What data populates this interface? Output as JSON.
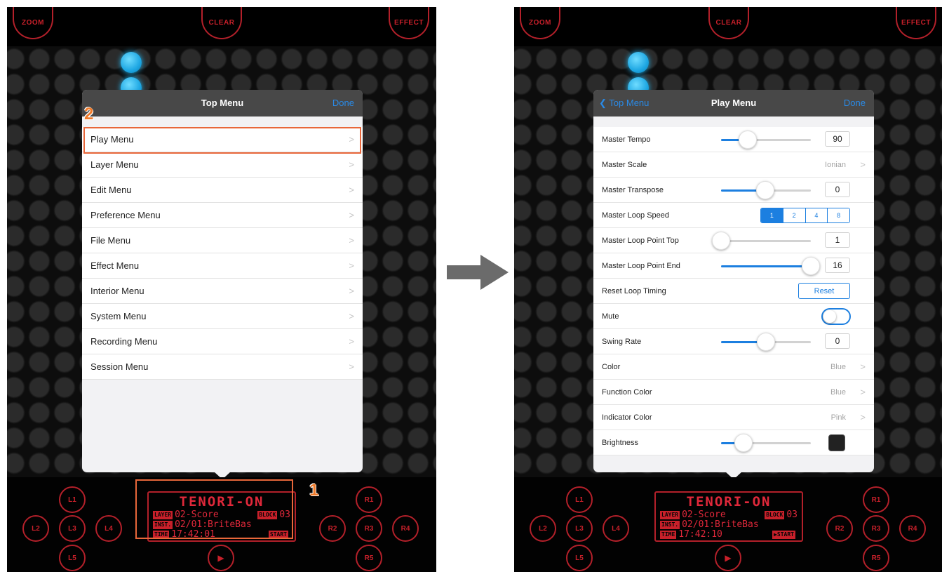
{
  "top_buttons": {
    "zoom": "ZOOM",
    "clear": "CLEAR",
    "effect": "EFFECT"
  },
  "layer_buttons": {
    "l1": "L1",
    "l2": "L2",
    "l3": "L3",
    "l4": "L4",
    "l5": "L5",
    "r1": "R1",
    "r2": "R2",
    "r3": "R3",
    "r4": "R4",
    "r5": "R5",
    "play": "▶"
  },
  "left": {
    "lcd": {
      "title": "TENORI-ON",
      "layer_tag": "LAYER",
      "layer_value": "02-Score",
      "block_tag": "BLOCK",
      "block_value": "03",
      "inst_tag": "INST.",
      "inst_value": "02/01:BriteBas",
      "time_tag": "TIME",
      "time_value": "17:42:01",
      "start_tag": "START"
    },
    "menu": {
      "title": "Top Menu",
      "done": "Done",
      "items": [
        "Play Menu",
        "Layer Menu",
        "Edit Menu",
        "Preference Menu",
        "File Menu",
        "Effect Menu",
        "Interior Menu",
        "System Menu",
        "Recording Menu",
        "Session Menu"
      ]
    },
    "step_labels": {
      "lcd": "1",
      "play_menu": "2"
    }
  },
  "right": {
    "lcd": {
      "title": "TENORI-ON",
      "layer_tag": "LAYER",
      "layer_value": "02-Score",
      "block_tag": "BLOCK",
      "block_value": "03",
      "inst_tag": "INST.",
      "inst_value": "02/01:BriteBas",
      "time_tag": "TIME",
      "time_value": "17:42:10",
      "start_tag": "▶START"
    },
    "menu": {
      "back": "Top Menu",
      "title": "Play Menu",
      "done": "Done",
      "rows": {
        "master_tempo": {
          "label": "Master Tempo",
          "value": "90",
          "slider_fraction": 0.3
        },
        "master_scale": {
          "label": "Master Scale",
          "value": "Ionian"
        },
        "master_transpose": {
          "label": "Master Transpose",
          "value": "0",
          "slider_fraction": 0.49
        },
        "master_loop_speed": {
          "label": "Master Loop Speed",
          "options": [
            "1",
            "2",
            "4",
            "8"
          ],
          "selected": "1"
        },
        "master_loop_point_top": {
          "label": "Master Loop Point Top",
          "value": "1",
          "slider_fraction": 0.0
        },
        "master_loop_point_end": {
          "label": "Master Loop Point End",
          "value": "16",
          "slider_fraction": 1.0
        },
        "reset_loop_timing": {
          "label": "Reset Loop Timing",
          "button": "Reset"
        },
        "mute": {
          "label": "Mute",
          "on": false
        },
        "swing_rate": {
          "label": "Swing Rate",
          "value": "0",
          "slider_fraction": 0.5
        },
        "color": {
          "label": "Color",
          "value": "Blue"
        },
        "function_color": {
          "label": "Function Color",
          "value": "Blue"
        },
        "indicator_color": {
          "label": "Indicator Color",
          "value": "Pink"
        },
        "brightness": {
          "label": "Brightness",
          "slider_fraction": 0.25
        }
      }
    }
  },
  "colors": {
    "accent_blue": "#1c7fe0",
    "lcd_red": "#e0283a",
    "highlight_orange": "#e8673a",
    "lit_cell": "#1ea7e3"
  }
}
